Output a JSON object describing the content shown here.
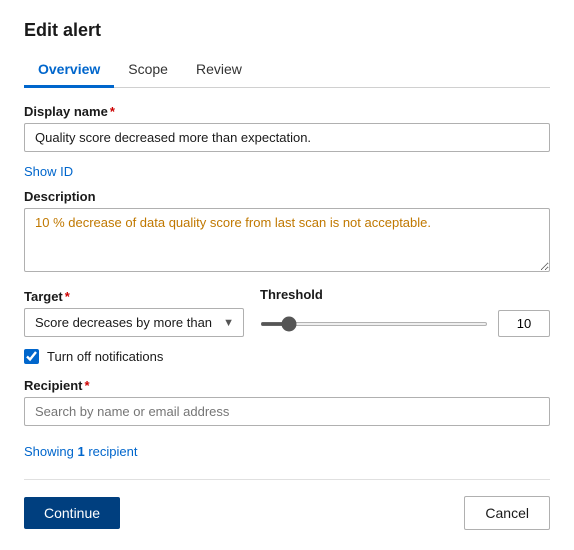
{
  "dialog": {
    "title": "Edit alert"
  },
  "tabs": [
    {
      "label": "Overview",
      "active": true
    },
    {
      "label": "Scope",
      "active": false
    },
    {
      "label": "Review",
      "active": false
    }
  ],
  "form": {
    "display_name_label": "Display name",
    "display_name_value": "Quality score decreased more than expectation.",
    "show_id_label": "Show ID",
    "description_label": "Description",
    "description_value": "10 % decrease of data quality score from last scan is not acceptable.",
    "target_label": "Target",
    "target_value": "Score decreases by more than",
    "threshold_label": "Threshold",
    "threshold_value": "10",
    "threshold_min": "0",
    "threshold_max": "100",
    "slider_value": "10",
    "notifications_label": "Turn off notifications",
    "notifications_checked": true,
    "recipient_label": "Recipient",
    "recipient_placeholder": "Search by name or email address",
    "showing_text_prefix": "Showing ",
    "showing_count": "1",
    "showing_text_suffix": " recipient"
  },
  "footer": {
    "continue_label": "Continue",
    "cancel_label": "Cancel"
  }
}
